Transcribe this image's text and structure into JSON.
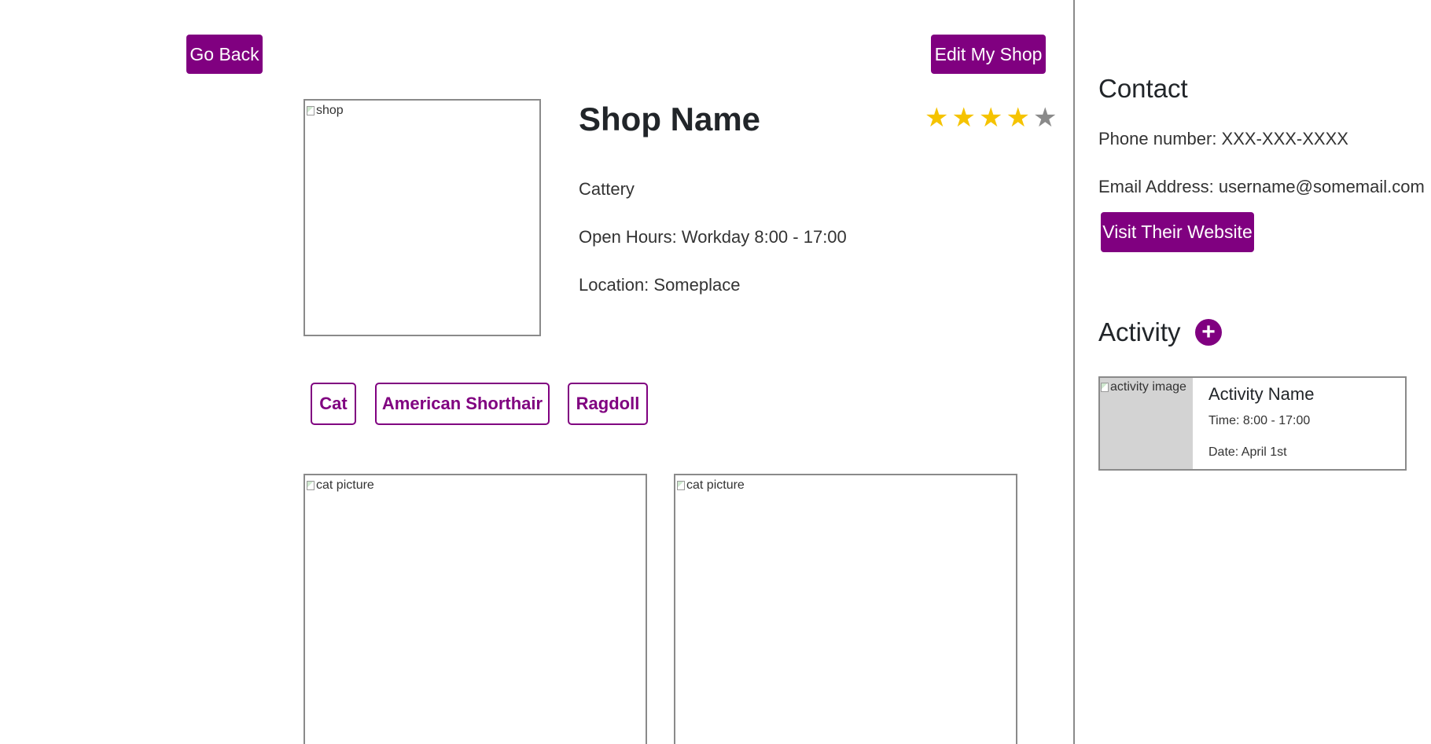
{
  "header": {
    "back_label": "Go Back",
    "edit_label": "Edit My Shop"
  },
  "shop": {
    "image_alt": "shop",
    "name": "Shop Name",
    "category": "Cattery",
    "hours": "Open Hours: Workday 8:00 - 17:00",
    "location": "Location: Someplace",
    "rating": {
      "value": 4,
      "max": 5,
      "filled_color": "#f5c300",
      "empty_color": "#8a8a8a"
    },
    "tags": [
      "Cat",
      "American Shorthair",
      "Ragdoll"
    ],
    "pictures": [
      {
        "alt": "cat picture"
      },
      {
        "alt": "cat picture"
      }
    ]
  },
  "contact": {
    "heading": "Contact",
    "phone": "Phone number: XXX-XXX-XXXX",
    "email": "Email Address: username@somemail.com",
    "website_label": "Visit Their Website"
  },
  "activity": {
    "heading": "Activity",
    "add_icon": "plus-circle-icon",
    "items": [
      {
        "image_alt": "activity image",
        "name": "Activity Name",
        "time": "Time: 8:00 - 17:00",
        "date": "Date: April 1st"
      }
    ]
  },
  "theme": {
    "accent": "#800080",
    "border": "#8a8a8a"
  }
}
